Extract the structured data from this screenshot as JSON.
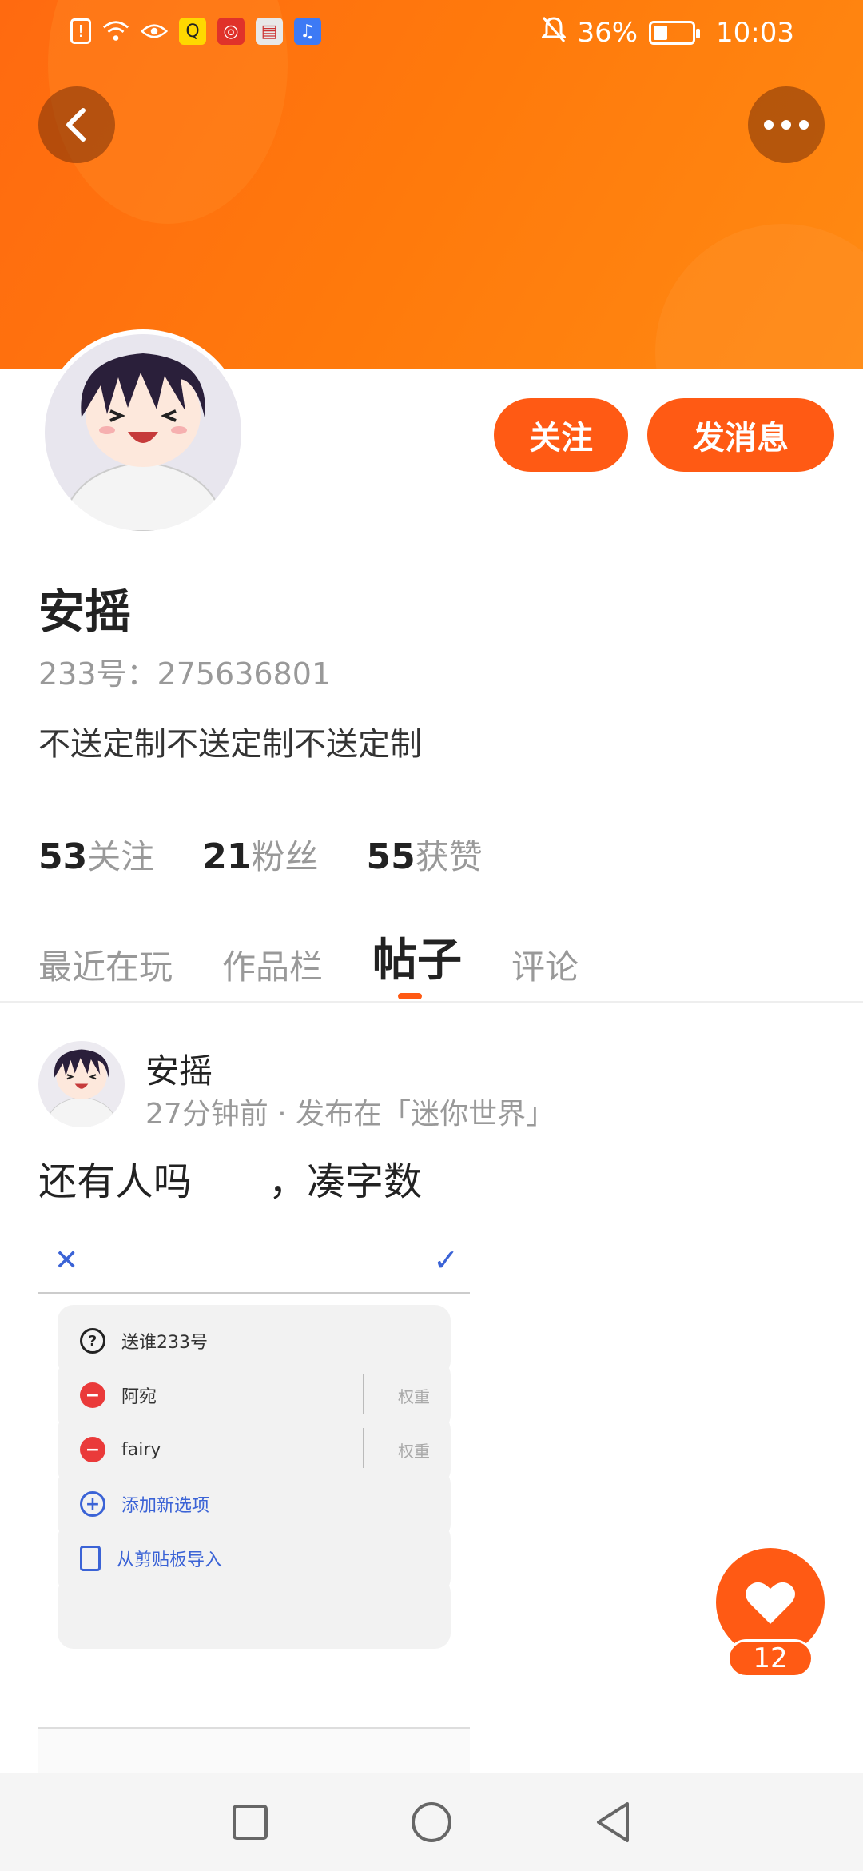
{
  "status_bar": {
    "battery": "36%",
    "time": "10:03",
    "battery_level": 0.36
  },
  "profile": {
    "name": "安摇",
    "uid": "233号：275636801",
    "bio": "不送定制不送定制不送定制",
    "follow_label": "关注",
    "message_label": "发消息"
  },
  "stats": [
    {
      "value": "53",
      "label": "关注"
    },
    {
      "value": "21",
      "label": "粉丝"
    },
    {
      "value": "55",
      "label": "获赞"
    }
  ],
  "tabs": [
    {
      "label": "最近在玩",
      "active": false
    },
    {
      "label": "作品栏",
      "active": false
    },
    {
      "label": "帖子",
      "active": true
    },
    {
      "label": "评论",
      "active": false
    }
  ],
  "post": {
    "author": "安摇",
    "meta": "27分钟前 · 发布在「迷你世界」",
    "text": "还有人吗　　，凑字数",
    "screenshot": {
      "rows": [
        {
          "label": "送谁233号",
          "icon": "question-icon"
        },
        {
          "label": "阿宛",
          "icon": "minus-icon",
          "weight": "权重"
        },
        {
          "label": "fairy",
          "icon": "minus-icon",
          "weight": "权重"
        },
        {
          "label": "添加新选项",
          "icon": "plus-icon"
        },
        {
          "label": "从剪贴板导入",
          "icon": "clipboard-icon"
        }
      ]
    }
  },
  "like": {
    "count": "12"
  },
  "colors": {
    "accent": "#ff5a14",
    "banner": "#ff7a0c"
  }
}
